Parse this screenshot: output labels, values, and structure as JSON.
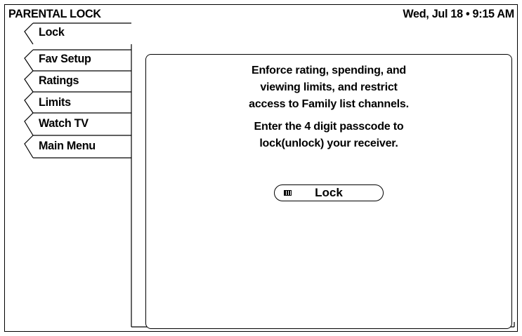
{
  "header": {
    "title": "PARENTAL LOCK",
    "datetime": "Wed, Jul 18 • 9:15 AM"
  },
  "tabs": [
    {
      "label": "Lock",
      "active": true
    },
    {
      "label": "Fav Setup",
      "active": false
    },
    {
      "label": "Ratings",
      "active": false
    },
    {
      "label": "Limits",
      "active": false
    },
    {
      "label": "Watch TV",
      "active": false
    },
    {
      "label": "Main Menu",
      "active": false
    }
  ],
  "content": {
    "description_lines": [
      "Enforce rating, spending, and",
      "viewing limits, and restrict",
      "access to Family list channels."
    ],
    "instruction_lines": [
      "Enter the 4 digit passcode to",
      "lock(unlock) your receiver."
    ],
    "button": {
      "label": "Lock",
      "icon": "keypad-icon"
    }
  }
}
